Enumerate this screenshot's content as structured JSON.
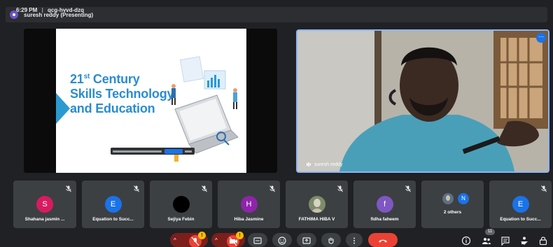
{
  "banner": {
    "presenting_text": "suresh reddy (Presenting)"
  },
  "slide": {
    "title_prefix": "21",
    "title_sup": "st",
    "title_rest": " Century Skills Technology and Education"
  },
  "speaker": {
    "name": "suresh reddy"
  },
  "participants": [
    {
      "name": "Shahana jasmin ...",
      "initial": "S",
      "color": "#d81b60",
      "muted": true
    },
    {
      "name": "Equation to Succ...",
      "initial": "E",
      "color": "#1a73e8",
      "muted": true
    },
    {
      "name": "Sejiya Febin",
      "initial": "",
      "color": "#000000",
      "muted": true
    },
    {
      "name": "Hiba Jasmine",
      "initial": "H",
      "color": "#8e24aa",
      "muted": true
    },
    {
      "name": "FATHIMA HIBA V",
      "initial": "",
      "color": "#6d7f5a",
      "muted": true
    },
    {
      "name": "fidha faheem",
      "initial": "f",
      "color": "#7e57c2",
      "muted": true
    },
    {
      "name": "2 others",
      "initial": "N",
      "color": "#1a73e8",
      "muted": false
    },
    {
      "name": "Equation to Succ...",
      "initial": "E",
      "color": "#1a73e8",
      "muted": true
    }
  ],
  "footer": {
    "time": "6:29 PM",
    "separator": "|",
    "meeting_code": "qcg-hvvd-dzq",
    "mic_badge": "!",
    "cam_badge": "!",
    "people_count": "11"
  },
  "colors": {
    "accent": "#1a73e8",
    "end_call": "#ea4335",
    "warning": "#fbbc04"
  },
  "icons": [
    "mic-off-icon",
    "camera-off-icon",
    "captions-icon",
    "emoji-icon",
    "present-icon",
    "raise-hand-icon",
    "more-options-icon",
    "end-call-icon",
    "info-icon",
    "people-icon",
    "chat-icon",
    "activities-icon",
    "host-controls-icon"
  ]
}
